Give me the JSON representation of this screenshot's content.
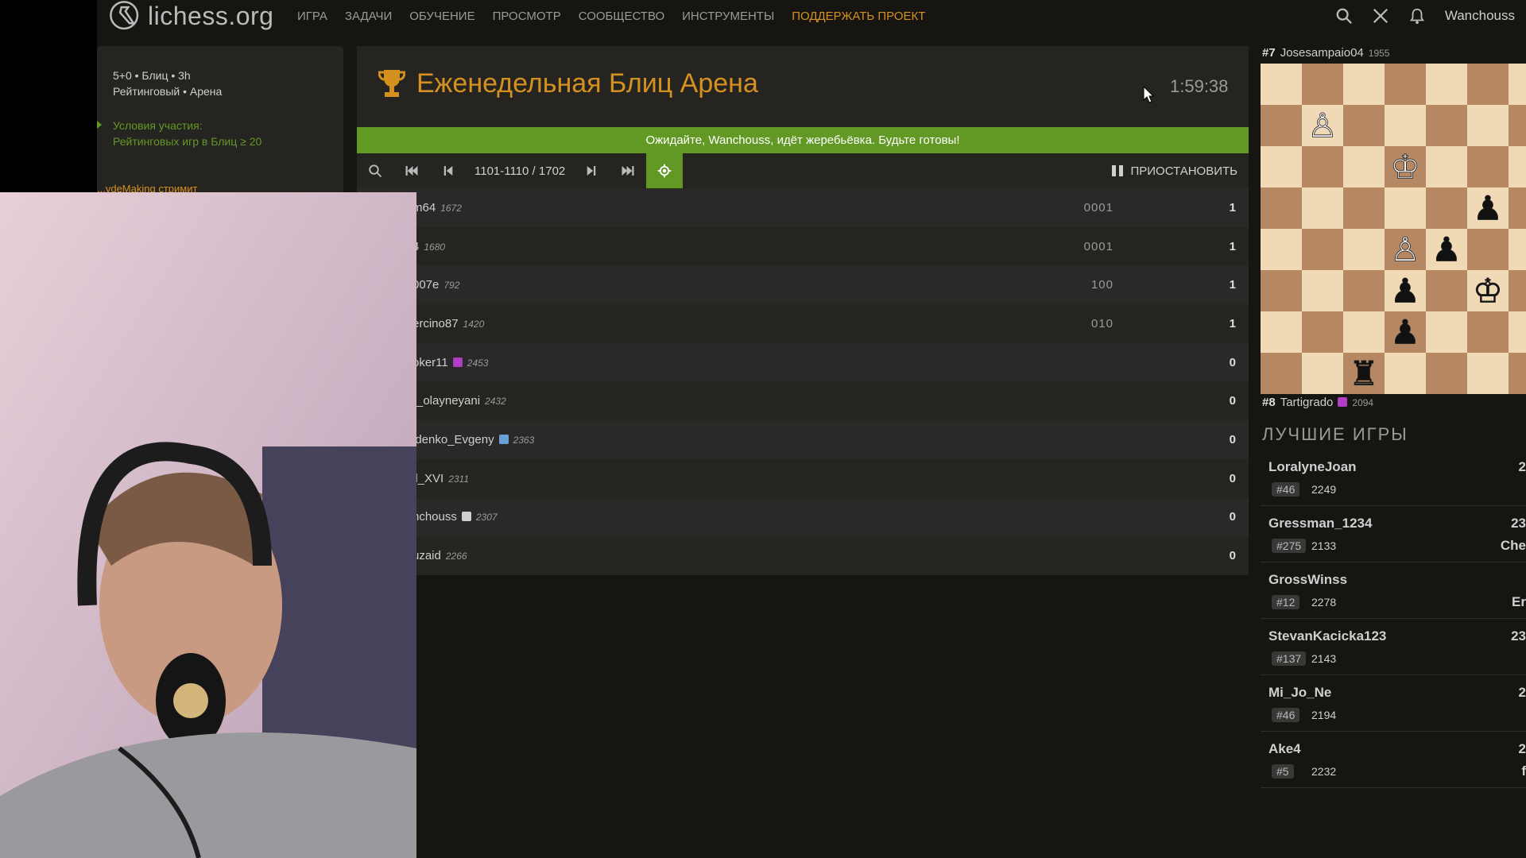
{
  "nav": {
    "logo_text": "lichess.org",
    "items": [
      "ИГРА",
      "ЗАДАЧИ",
      "ОБУЧЕНИЕ",
      "ПРОСМОТР",
      "СООБЩЕСТВО",
      "ИНСТРУМЕНТЫ"
    ],
    "donate": "ПОДДЕРЖАТЬ ПРОЕКТ",
    "username": "Wanchouss"
  },
  "side": {
    "line1": "5+0 • Блиц • 3h",
    "line2": "Рейтинговый • Арена",
    "cond_title": "Условия участия:",
    "cond_text": "Рейтинговых игр в Блиц ≥ 20",
    "stream": "...vdeMaking стримит"
  },
  "tournament": {
    "title": "Еженедельная Блиц Арена",
    "clock": "1:59:38",
    "banner": "Ожидайте, Wanchouss, идёт жеребьёвка. Будьте готовы!",
    "pager_text": "1101-1110 / 1702",
    "pause_label": "ПРИОСТАНОВИТЬ",
    "rows": [
      {
        "name": "m64",
        "rating": "1672",
        "sheet": "0001",
        "score": "1",
        "badge": ""
      },
      {
        "name": "4",
        "rating": "1680",
        "sheet": "0001",
        "score": "1",
        "badge": ""
      },
      {
        "name": "007e",
        "rating": "792",
        "sheet": "100",
        "score": "1",
        "badge": ""
      },
      {
        "name": "ercino87",
        "rating": "1420",
        "sheet": "010",
        "score": "1",
        "badge": ""
      },
      {
        "name": "oker11",
        "rating": "2453",
        "sheet": "",
        "score": "0",
        "badge": "#b23cc4"
      },
      {
        "name": "r_olayneyani",
        "rating": "2432",
        "sheet": "",
        "score": "0",
        "badge": ""
      },
      {
        "name": "idenko_Evgeny",
        "rating": "2363",
        "sheet": "",
        "score": "0",
        "badge": "#6aa0d8"
      },
      {
        "name": "ll_XVI",
        "rating": "2311",
        "sheet": "",
        "score": "0",
        "badge": ""
      },
      {
        "name": "nchouss",
        "rating": "2307",
        "sheet": "",
        "score": "0",
        "badge": "#cfcfcf"
      },
      {
        "name": "uzaid",
        "rating": "2266",
        "sheet": "",
        "score": "0",
        "badge": ""
      }
    ]
  },
  "board": {
    "top_rank": "#7",
    "top_name": "Josesampaio04",
    "top_rating": "1955",
    "bottom_rank": "#8",
    "bottom_name": "Tartigrado",
    "bottom_rating": "2094"
  },
  "best_games": {
    "title": "ЛУЧШИЕ ИГРЫ",
    "games": [
      {
        "name": "LoralyneJoan",
        "rank": "#46",
        "rating": "2249",
        "extra": "2",
        "extra2": ""
      },
      {
        "name": "Gressman_1234",
        "rank": "#275",
        "rating": "2133",
        "extra": "23",
        "extra2": "Che"
      },
      {
        "name": "GrossWinss",
        "rank": "#12",
        "rating": "2278",
        "extra": "",
        "extra2": "Er"
      },
      {
        "name": "StevanKacicka123",
        "rank": "#137",
        "rating": "2143",
        "extra": "23",
        "extra2": ""
      },
      {
        "name": "Mi_Jo_Ne",
        "rank": "#46",
        "rating": "2194",
        "extra": "2",
        "extra2": ""
      },
      {
        "name": "Ake4",
        "rank": "#5",
        "rating": "2232",
        "extra": "2",
        "extra2": "f"
      }
    ]
  },
  "colors": {
    "accent": "#d59120",
    "green": "#629924",
    "bg": "#161512",
    "panel": "#262421"
  }
}
